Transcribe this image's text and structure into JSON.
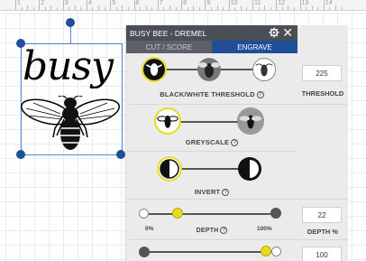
{
  "ruler": {
    "numbers": [
      "1",
      "2",
      "3",
      "4",
      "5",
      "6",
      "7",
      "8",
      "9",
      "10",
      "11",
      "12",
      "13",
      "14"
    ]
  },
  "design": {
    "text": "busy"
  },
  "panel": {
    "title": "BUSY BEE - DREMEL",
    "tabs": [
      {
        "label": "CUT / SCORE",
        "active": false
      },
      {
        "label": "ENGRAVE",
        "active": true
      }
    ],
    "threshold": {
      "label": "BLACK/WHITE THRESHOLD",
      "value": "225",
      "value_label": "THRESHOLD"
    },
    "greyscale": {
      "label": "GREYSCALE"
    },
    "invert": {
      "label": "INVERT"
    },
    "depth": {
      "label": "DEPTH",
      "min_label": "0%",
      "max_label": "100%",
      "value": "22",
      "value_label": "DEPTH %"
    },
    "last": {
      "value": "100"
    }
  },
  "colors": {
    "header": "#4a4e55",
    "active_tab": "#1f4f99",
    "accent_yellow": "#e8dc1e",
    "handle": "#1f4f99"
  }
}
